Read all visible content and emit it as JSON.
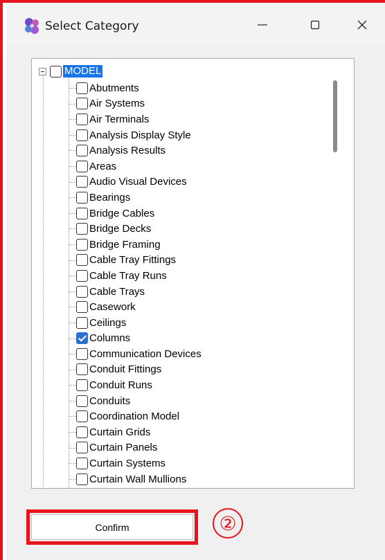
{
  "window": {
    "title": "Select Category",
    "minimize_icon": "minimize-icon",
    "maximize_icon": "maximize-icon",
    "close_icon": "close-icon"
  },
  "tree": {
    "root_label": "MODEL",
    "items": [
      {
        "label": "Abutments",
        "checked": false
      },
      {
        "label": "Air Systems",
        "checked": false
      },
      {
        "label": "Air Terminals",
        "checked": false
      },
      {
        "label": "Analysis Display Style",
        "checked": false
      },
      {
        "label": "Analysis Results",
        "checked": false
      },
      {
        "label": "Areas",
        "checked": false
      },
      {
        "label": "Audio Visual Devices",
        "checked": false
      },
      {
        "label": "Bearings",
        "checked": false
      },
      {
        "label": "Bridge Cables",
        "checked": false
      },
      {
        "label": "Bridge Decks",
        "checked": false
      },
      {
        "label": "Bridge Framing",
        "checked": false
      },
      {
        "label": "Cable Tray Fittings",
        "checked": false
      },
      {
        "label": "Cable Tray Runs",
        "checked": false
      },
      {
        "label": "Cable Trays",
        "checked": false
      },
      {
        "label": "Casework",
        "checked": false
      },
      {
        "label": "Ceilings",
        "checked": false
      },
      {
        "label": "Columns",
        "checked": true
      },
      {
        "label": "Communication Devices",
        "checked": false
      },
      {
        "label": "Conduit Fittings",
        "checked": false
      },
      {
        "label": "Conduit Runs",
        "checked": false
      },
      {
        "label": "Conduits",
        "checked": false
      },
      {
        "label": "Coordination Model",
        "checked": false
      },
      {
        "label": "Curtain Grids",
        "checked": false
      },
      {
        "label": "Curtain Panels",
        "checked": false
      },
      {
        "label": "Curtain Systems",
        "checked": false
      },
      {
        "label": "Curtain Wall Mullions",
        "checked": false
      }
    ]
  },
  "footer": {
    "confirm_label": "Confirm",
    "step_marker": "②"
  },
  "colors": {
    "annotation_red": "#e8141b",
    "selection_blue": "#1874e8",
    "checkbox_blue": "#2d6fd3"
  }
}
